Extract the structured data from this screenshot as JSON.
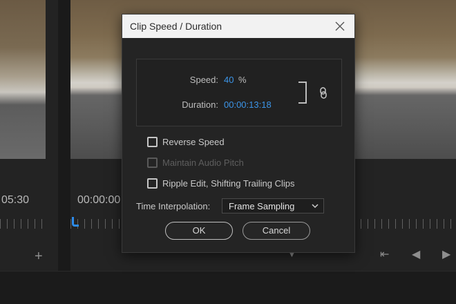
{
  "background": {
    "left_timecode": "05:30",
    "right_timecode": "00:00:00"
  },
  "dialog": {
    "title": "Clip Speed / Duration",
    "speed_label": "Speed:",
    "speed_value": "40",
    "speed_unit": "%",
    "duration_label": "Duration:",
    "duration_value": "00:00:13:18",
    "reverse_speed_label": "Reverse Speed",
    "maintain_pitch_label": "Maintain Audio Pitch",
    "ripple_edit_label": "Ripple Edit, Shifting Trailing Clips",
    "interpolation_label": "Time Interpolation:",
    "interpolation_value": "Frame Sampling",
    "ok_label": "OK",
    "cancel_label": "Cancel"
  },
  "colors": {
    "accent": "#3c95e8",
    "playhead": "#2d8ceb"
  },
  "icons": [
    "close-icon",
    "link-icon",
    "chevron-down-icon",
    "add-icon",
    "marker-icon",
    "step-back-icon",
    "play-icon"
  ]
}
